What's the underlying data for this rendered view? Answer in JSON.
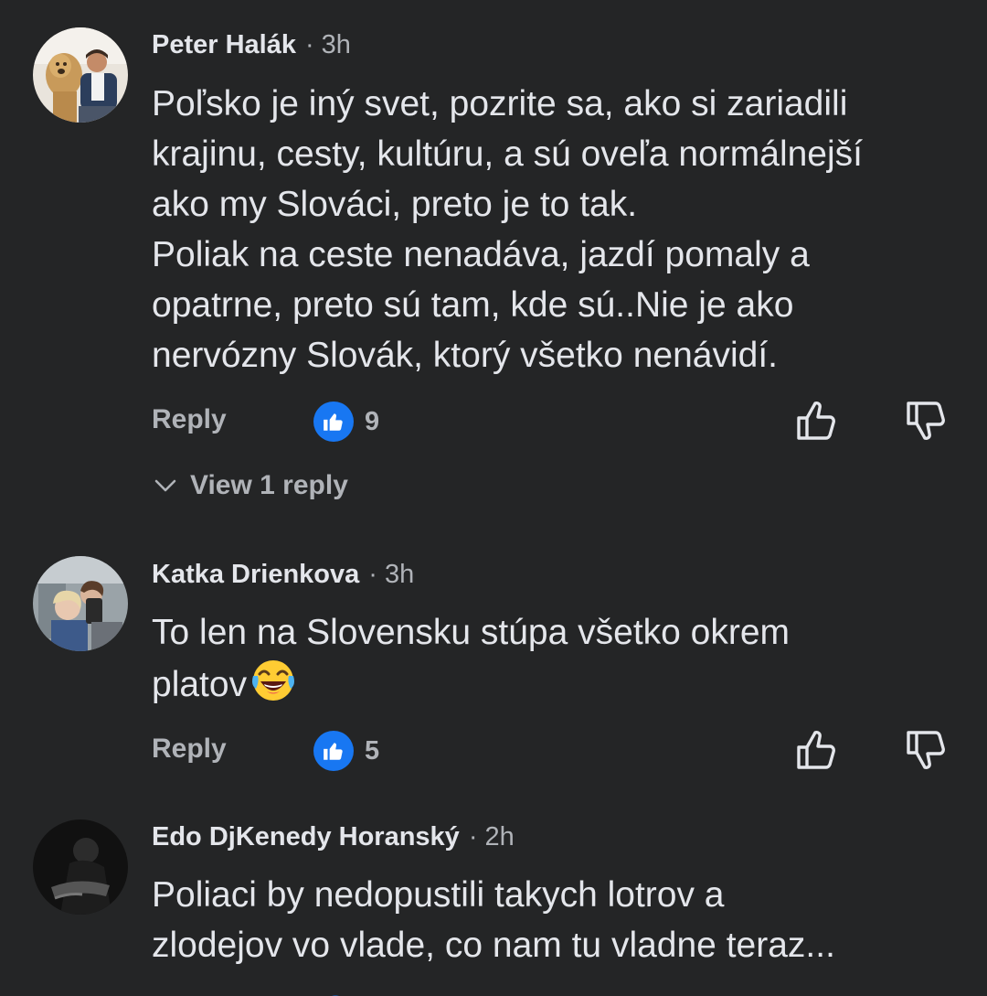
{
  "comments": [
    {
      "author": "Peter Halák",
      "time": "3h",
      "text_lines": [
        "Poľsko je iný svet, pozrite sa, ako si zariadili",
        "krajinu, cesty, kultúru, a sú oveľa normálnejší",
        "ako my Slováci, preto je to tak.",
        "Poliak na ceste nenadáva, jazdí pomaly a",
        "opatrne, preto sú tam, kde sú..Nie je ako",
        "nervózny Slovák, ktorý všetko nenávidí."
      ],
      "reply_label": "Reply",
      "reaction_count": "9",
      "view_replies_label": "View 1 reply"
    },
    {
      "author": "Katka Drienkova",
      "time": "3h",
      "text_lines": [
        "To len na Slovensku stúpa všetko okrem",
        "platov"
      ],
      "emoji": "tears-of-joy-emoji",
      "reply_label": "Reply",
      "reaction_count": "5"
    },
    {
      "author": "Edo DjKenedy Horanský",
      "time": "2h",
      "text_lines": [
        "Poliaci by nedopustili takych lotrov a",
        "zlodejov vo vlade, co nam tu vladne teraz..."
      ]
    }
  ],
  "separator": "·",
  "colors": {
    "background": "#242526",
    "primary_text": "#e4e6eb",
    "secondary_text": "#b0b3b8",
    "like_blue": "#1877f2"
  },
  "icons": [
    "like-reaction-icon",
    "thumbs-up-icon",
    "thumbs-down-icon",
    "chevron-down-icon",
    "tears-of-joy-emoji"
  ]
}
